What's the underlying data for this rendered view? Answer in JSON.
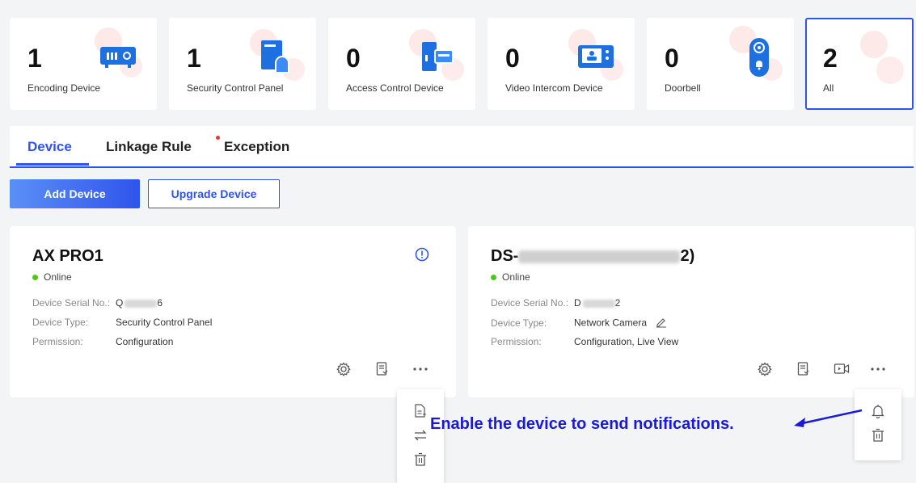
{
  "stats": [
    {
      "count": "1",
      "label": "Encoding Device",
      "icon": "encoding-device-icon"
    },
    {
      "count": "1",
      "label": "Security Control Panel",
      "icon": "security-panel-icon"
    },
    {
      "count": "0",
      "label": "Access Control Device",
      "icon": "access-control-icon"
    },
    {
      "count": "0",
      "label": "Video Intercom Device",
      "icon": "video-intercom-icon"
    },
    {
      "count": "0",
      "label": "Doorbell",
      "icon": "doorbell-icon"
    },
    {
      "count": "2",
      "label": "All",
      "icon": ""
    }
  ],
  "tabs": [
    {
      "label": "Device",
      "active": true
    },
    {
      "label": "Linkage Rule",
      "active": false
    },
    {
      "label": "Exception",
      "active": false,
      "badge": true
    }
  ],
  "toolbar": {
    "add_label": "Add Device",
    "upgrade_label": "Upgrade Device"
  },
  "devices": [
    {
      "name": "AX PRO1",
      "status": "Online",
      "serial_label": "Device Serial No.:",
      "serial_prefix": "Q",
      "serial_suffix": "6",
      "type_label": "Device Type:",
      "type_value": "Security Control Panel",
      "perm_label": "Permission:",
      "perm_value": "Configuration"
    },
    {
      "name_prefix": "DS-",
      "name_suffix": "2)",
      "status": "Online",
      "serial_label": "Device Serial No.:",
      "serial_prefix": "D",
      "serial_suffix": "2",
      "type_label": "Device Type:",
      "type_value": "Network Camera",
      "perm_label": "Permission:",
      "perm_value": "Configuration, Live View"
    }
  ],
  "annotation": "Enable the device to send notifications.",
  "colors": {
    "accent": "#2f54eb",
    "online": "#52c41a",
    "annotation": "#1a1ad6",
    "badge": "#e53935"
  }
}
